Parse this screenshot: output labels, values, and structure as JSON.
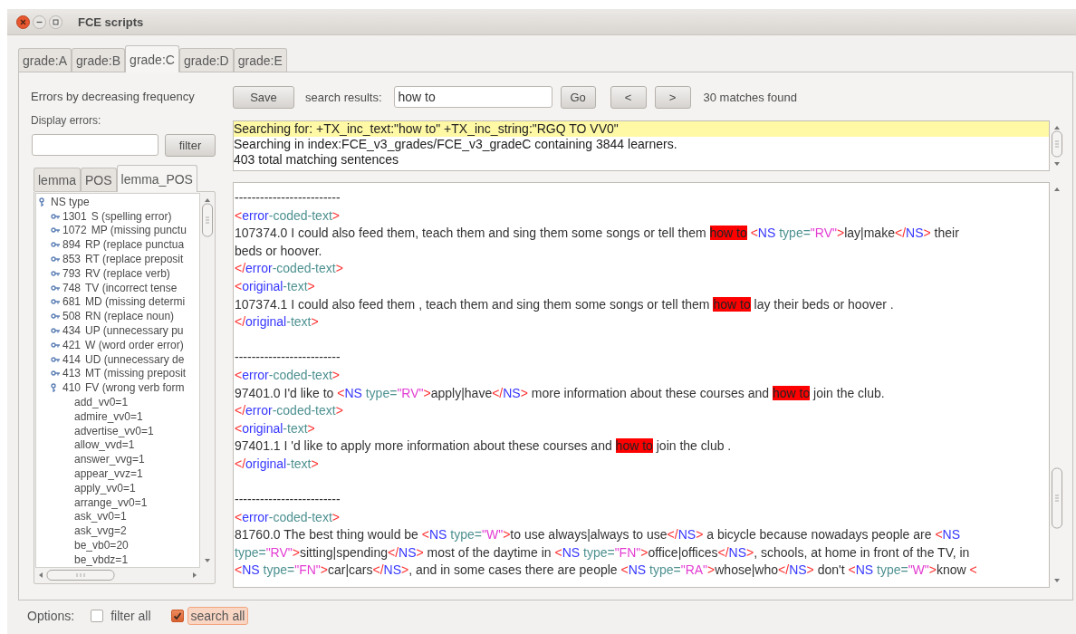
{
  "window": {
    "title": "FCE scripts"
  },
  "tabs": [
    {
      "label": "grade:A",
      "selected": false
    },
    {
      "label": "grade:B",
      "selected": false
    },
    {
      "label": "grade:C",
      "selected": true
    },
    {
      "label": "grade:D",
      "selected": false
    },
    {
      "label": "grade:E",
      "selected": false
    }
  ],
  "left": {
    "heading": "Errors by decreasing frequency",
    "display_label": "Display errors:",
    "filter_button": "filter",
    "subtabs": [
      {
        "label": "lemma",
        "selected": false
      },
      {
        "label": "POS",
        "selected": false
      },
      {
        "label": "lemma_POS",
        "selected": true
      }
    ],
    "tree": [
      {
        "label": "NS type",
        "expanded": true,
        "children": [
          {
            "count": "1301",
            "label": "S (spelling error)",
            "expanded": false
          },
          {
            "count": "1072",
            "label": "MP (missing punctu",
            "expanded": false
          },
          {
            "count": "894",
            "label": "RP (replace punctua",
            "expanded": false
          },
          {
            "count": "853",
            "label": "RT (replace preposit",
            "expanded": false
          },
          {
            "count": "793",
            "label": "RV (replace verb)",
            "expanded": false
          },
          {
            "count": "748",
            "label": "TV (incorrect tense",
            "expanded": false
          },
          {
            "count": "681",
            "label": "MD (missing determi",
            "expanded": false
          },
          {
            "count": "508",
            "label": "RN (replace noun)",
            "expanded": false
          },
          {
            "count": "434",
            "label": "UP (unnecessary pu",
            "expanded": false
          },
          {
            "count": "421",
            "label": "W (word order error)",
            "expanded": false
          },
          {
            "count": "414",
            "label": "UD (unnecessary de",
            "expanded": false
          },
          {
            "count": "413",
            "label": "MT (missing preposit",
            "expanded": false
          },
          {
            "count": "410",
            "label": "FV (wrong verb form",
            "expanded": true,
            "children": [
              {
                "label": "add_vv0=1"
              },
              {
                "label": "admire_vv0=1"
              },
              {
                "label": "advertise_vv0=1"
              },
              {
                "label": "allow_vvd=1"
              },
              {
                "label": "answer_vvg=1"
              },
              {
                "label": "appear_vvz=1"
              },
              {
                "label": "apply_vv0=1"
              },
              {
                "label": "arrange_vv0=1"
              },
              {
                "label": "ask_vv0=1"
              },
              {
                "label": "ask_vvg=2"
              },
              {
                "label": "be_vb0=20"
              },
              {
                "label": "be_vbdz=1"
              }
            ]
          }
        ]
      }
    ]
  },
  "toolbar": {
    "save_button": "Save",
    "search_label": "search results:",
    "search_value": "how to",
    "go_button": "Go",
    "prev_button": "<",
    "next_button": ">",
    "matches": "30 matches found"
  },
  "info": {
    "lines": [
      {
        "text": "Searching for: +TX_inc_text:\"how to\" +TX_inc_string:\"RGQ TO VV0\"",
        "highlighted": true
      },
      {
        "text": "Searching in index:FCE_v3_grades/FCE_v3_gradeC containing 3844 learners.",
        "highlighted": false
      },
      {
        "text": "403 total matching sentences",
        "highlighted": false
      }
    ]
  },
  "results": {
    "records": [
      {
        "separator": "-------------------------",
        "lines": [
          {
            "segments": [
              {
                "kind": "punct",
                "text": "<"
              },
              {
                "kind": "tag",
                "text": "error"
              },
              {
                "kind": "attr",
                "text": "-coded-text"
              },
              {
                "kind": "punct",
                "text": ">"
              }
            ]
          },
          {
            "segments": [
              {
                "kind": "plain",
                "text": "107374.0 I could also feed them, teach them and sing them some songs or tell them "
              },
              {
                "kind": "match",
                "text": "how to"
              },
              {
                "kind": "punct",
                "text": " <"
              },
              {
                "kind": "tag",
                "text": "NS"
              },
              {
                "kind": "attr",
                "text": " type="
              },
              {
                "kind": "value",
                "text": "\"RV\""
              },
              {
                "kind": "punct",
                "text": ">"
              },
              {
                "kind": "plain",
                "text": "lay|make"
              },
              {
                "kind": "punct",
                "text": "</"
              },
              {
                "kind": "tag",
                "text": "NS"
              },
              {
                "kind": "punct",
                "text": ">"
              },
              {
                "kind": "plain",
                "text": " their"
              }
            ]
          },
          {
            "segments": [
              {
                "kind": "plain",
                "text": "beds or hoover."
              }
            ]
          },
          {
            "segments": [
              {
                "kind": "punct",
                "text": "</"
              },
              {
                "kind": "tag",
                "text": "error"
              },
              {
                "kind": "attr",
                "text": "-coded-text"
              },
              {
                "kind": "punct",
                "text": ">"
              }
            ]
          },
          {
            "segments": [
              {
                "kind": "punct",
                "text": "<"
              },
              {
                "kind": "tag",
                "text": "original"
              },
              {
                "kind": "attr",
                "text": "-text"
              },
              {
                "kind": "punct",
                "text": ">"
              }
            ]
          },
          {
            "segments": [
              {
                "kind": "plain",
                "text": "107374.1 I could also feed them , teach them and sing them some songs or tell them "
              },
              {
                "kind": "match",
                "text": "how to"
              },
              {
                "kind": "plain",
                "text": " lay their beds or hoover ."
              }
            ]
          },
          {
            "segments": [
              {
                "kind": "punct",
                "text": "</"
              },
              {
                "kind": "tag",
                "text": "original"
              },
              {
                "kind": "attr",
                "text": "-text"
              },
              {
                "kind": "punct",
                "text": ">"
              }
            ]
          }
        ]
      },
      {
        "separator": "-------------------------",
        "lines": [
          {
            "segments": [
              {
                "kind": "punct",
                "text": "<"
              },
              {
                "kind": "tag",
                "text": "error"
              },
              {
                "kind": "attr",
                "text": "-coded-text"
              },
              {
                "kind": "punct",
                "text": ">"
              }
            ]
          },
          {
            "segments": [
              {
                "kind": "plain",
                "text": "97401.0 I'd like to "
              },
              {
                "kind": "punct",
                "text": "<"
              },
              {
                "kind": "tag",
                "text": "NS"
              },
              {
                "kind": "attr",
                "text": " type="
              },
              {
                "kind": "value",
                "text": "\"RV\""
              },
              {
                "kind": "punct",
                "text": ">"
              },
              {
                "kind": "plain",
                "text": "apply|have"
              },
              {
                "kind": "punct",
                "text": "</"
              },
              {
                "kind": "tag",
                "text": "NS"
              },
              {
                "kind": "punct",
                "text": ">"
              },
              {
                "kind": "plain",
                "text": " more information about these courses and "
              },
              {
                "kind": "match",
                "text": "how to"
              },
              {
                "kind": "plain",
                "text": " join the club."
              }
            ]
          },
          {
            "segments": [
              {
                "kind": "punct",
                "text": "</"
              },
              {
                "kind": "tag",
                "text": "error"
              },
              {
                "kind": "attr",
                "text": "-coded-text"
              },
              {
                "kind": "punct",
                "text": ">"
              }
            ]
          },
          {
            "segments": [
              {
                "kind": "punct",
                "text": "<"
              },
              {
                "kind": "tag",
                "text": "original"
              },
              {
                "kind": "attr",
                "text": "-text"
              },
              {
                "kind": "punct",
                "text": ">"
              }
            ]
          },
          {
            "segments": [
              {
                "kind": "plain",
                "text": "97401.1 I 'd like to apply more information about these courses and "
              },
              {
                "kind": "match",
                "text": "how to"
              },
              {
                "kind": "plain",
                "text": " join the club ."
              }
            ]
          },
          {
            "segments": [
              {
                "kind": "punct",
                "text": "</"
              },
              {
                "kind": "tag",
                "text": "original"
              },
              {
                "kind": "attr",
                "text": "-text"
              },
              {
                "kind": "punct",
                "text": ">"
              }
            ]
          }
        ]
      },
      {
        "separator": "-------------------------",
        "lines": [
          {
            "segments": [
              {
                "kind": "punct",
                "text": "<"
              },
              {
                "kind": "tag",
                "text": "error"
              },
              {
                "kind": "attr",
                "text": "-coded-text"
              },
              {
                "kind": "punct",
                "text": ">"
              }
            ]
          },
          {
            "segments": [
              {
                "kind": "plain",
                "text": "81760.0 The best thing would be "
              },
              {
                "kind": "punct",
                "text": "<"
              },
              {
                "kind": "tag",
                "text": "NS"
              },
              {
                "kind": "attr",
                "text": " type="
              },
              {
                "kind": "value",
                "text": "\"W\""
              },
              {
                "kind": "punct",
                "text": ">"
              },
              {
                "kind": "plain",
                "text": "to use always|always to use"
              },
              {
                "kind": "punct",
                "text": "</"
              },
              {
                "kind": "tag",
                "text": "NS"
              },
              {
                "kind": "punct",
                "text": ">"
              },
              {
                "kind": "plain",
                "text": " a bicycle because nowadays people are "
              },
              {
                "kind": "punct",
                "text": "<"
              },
              {
                "kind": "tag",
                "text": "NS"
              }
            ]
          },
          {
            "segments": [
              {
                "kind": "attr",
                "text": "type="
              },
              {
                "kind": "value",
                "text": "\"RV\""
              },
              {
                "kind": "punct",
                "text": ">"
              },
              {
                "kind": "plain",
                "text": "sitting|spending"
              },
              {
                "kind": "punct",
                "text": "</"
              },
              {
                "kind": "tag",
                "text": "NS"
              },
              {
                "kind": "punct",
                "text": ">"
              },
              {
                "kind": "plain",
                "text": " most of the daytime in "
              },
              {
                "kind": "punct",
                "text": "<"
              },
              {
                "kind": "tag",
                "text": "NS"
              },
              {
                "kind": "attr",
                "text": " type="
              },
              {
                "kind": "value",
                "text": "\"FN\""
              },
              {
                "kind": "punct",
                "text": ">"
              },
              {
                "kind": "plain",
                "text": "office|offices"
              },
              {
                "kind": "punct",
                "text": "</"
              },
              {
                "kind": "tag",
                "text": "NS"
              },
              {
                "kind": "punct",
                "text": ">"
              },
              {
                "kind": "plain",
                "text": ", schools, at home in front of the TV, in"
              }
            ]
          },
          {
            "segments": [
              {
                "kind": "punct",
                "text": "<"
              },
              {
                "kind": "tag",
                "text": "NS"
              },
              {
                "kind": "attr",
                "text": " type="
              },
              {
                "kind": "value",
                "text": "\"FN\""
              },
              {
                "kind": "punct",
                "text": ">"
              },
              {
                "kind": "plain",
                "text": "car|cars"
              },
              {
                "kind": "punct",
                "text": "</"
              },
              {
                "kind": "tag",
                "text": "NS"
              },
              {
                "kind": "punct",
                "text": ">"
              },
              {
                "kind": "plain",
                "text": ", and in some cases there are people "
              },
              {
                "kind": "punct",
                "text": "<"
              },
              {
                "kind": "tag",
                "text": "NS"
              },
              {
                "kind": "attr",
                "text": " type="
              },
              {
                "kind": "value",
                "text": "\"RA\""
              },
              {
                "kind": "punct",
                "text": ">"
              },
              {
                "kind": "plain",
                "text": "whose|who"
              },
              {
                "kind": "punct",
                "text": "</"
              },
              {
                "kind": "tag",
                "text": "NS"
              },
              {
                "kind": "punct",
                "text": ">"
              },
              {
                "kind": "plain",
                "text": " don't "
              },
              {
                "kind": "punct",
                "text": "<"
              },
              {
                "kind": "tag",
                "text": "NS"
              },
              {
                "kind": "attr",
                "text": " type="
              },
              {
                "kind": "value",
                "text": "\"W\""
              },
              {
                "kind": "punct",
                "text": ">"
              },
              {
                "kind": "plain",
                "text": "know "
              },
              {
                "kind": "punct",
                "text": "<"
              }
            ]
          }
        ]
      }
    ]
  },
  "options": {
    "label": "Options:",
    "items": [
      {
        "label": "filter all",
        "checked": false,
        "focused": false
      },
      {
        "label": "search all",
        "checked": true,
        "focused": true
      }
    ]
  }
}
